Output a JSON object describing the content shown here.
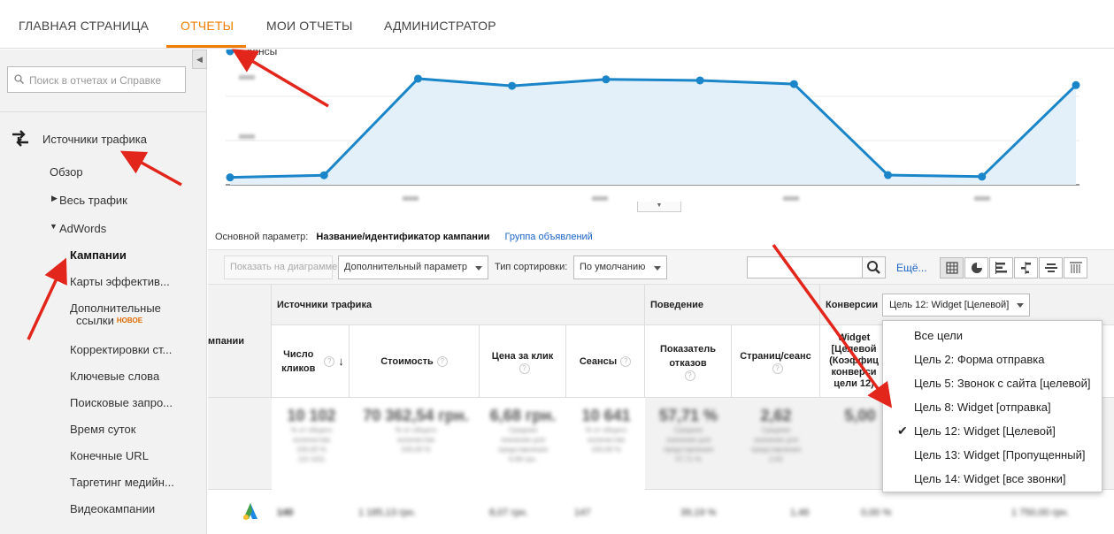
{
  "nav": {
    "tabs": [
      "ГЛАВНАЯ СТРАНИЦА",
      "ОТЧЕТЫ",
      "МОИ ОТЧЕТЫ",
      "АДМИНИСТРАТОР"
    ]
  },
  "sidebar": {
    "search_placeholder": "Поиск в отчетах и Справке",
    "section_title": "Источники трафика",
    "items": {
      "overview": "Обзор",
      "all_traffic": "Весь трафик",
      "adwords": "AdWords",
      "campaigns": "Кампании",
      "heatmaps": "Карты эффектив...",
      "sitelinks_l1": "Дополнительные",
      "sitelinks_l2": "ссылки",
      "new_badge": "НОВОЕ",
      "bid_adjust": "Корректировки ст...",
      "keywords": "Ключевые слова",
      "search_queries": "Поисковые запро...",
      "hour_of_day": "Время суток",
      "final_urls": "Конечные URL",
      "display_targeting": "Таргетинг медийн...",
      "video_campaigns": "Видеокампании"
    }
  },
  "chart_data": {
    "type": "area",
    "legend": "Сеансы",
    "series": [
      {
        "name": "Сеансы",
        "values": [
          102,
          132,
          1470,
          1370,
          1460,
          1445,
          1395,
          134,
          113,
          1380
        ]
      }
    ],
    "ylim": [
      0,
      1800
    ],
    "color": "#1a85c8",
    "fill": "#e3f0f9"
  },
  "params": {
    "label": "Основной параметр:",
    "active": "Название/идентификатор кампании",
    "alt_link": "Группа объявлений"
  },
  "toolbar": {
    "show_chart": "Показать на диаграмме",
    "secondary_dim": "Дополнительный параметр",
    "sort_label": "Тип сортировки:",
    "sort_value": "По умолчанию",
    "more": "Ещё..."
  },
  "table": {
    "campaign_col": "мпании",
    "groups": {
      "traffic": "Источники трафика",
      "behavior": "Поведение",
      "conversions": "Конверсии"
    },
    "headers": {
      "clicks": "Число кликов",
      "cost": "Стоимость",
      "cpc": "Цена за клик",
      "sessions": "Сеансы",
      "bounce": "Показатель отказов",
      "pages": "Страниц/сеанс",
      "goal_col_lines": [
        "Widget",
        "[Целевой",
        "(Коэффиц",
        "конверси",
        "цели 12)"
      ]
    },
    "summary": [
      "10 102",
      "70 362,54 грн.",
      "6,68 грн.",
      "10 641",
      "57,71 %",
      "2,62",
      "5,00"
    ],
    "row1": [
      "140",
      "1 185,13 грн.",
      "8,07 грн.",
      "147",
      "39,19 %",
      "1,46",
      "0,00 %",
      "1 750,00 грн."
    ]
  },
  "goal_select": {
    "value": "Цель 12: Widget [Целевой]",
    "options": [
      "Все цели",
      "Цель 2: Форма отправка",
      "Цель 5: Звонок с сайта [целевой]",
      "Цель 8: Widget [отправка]",
      "Цель 12: Widget [Целевой]",
      "Цель 13: Widget [Пропущенный]",
      "Цель 14: Widget [все звонки]"
    ],
    "selected_index": 4
  }
}
